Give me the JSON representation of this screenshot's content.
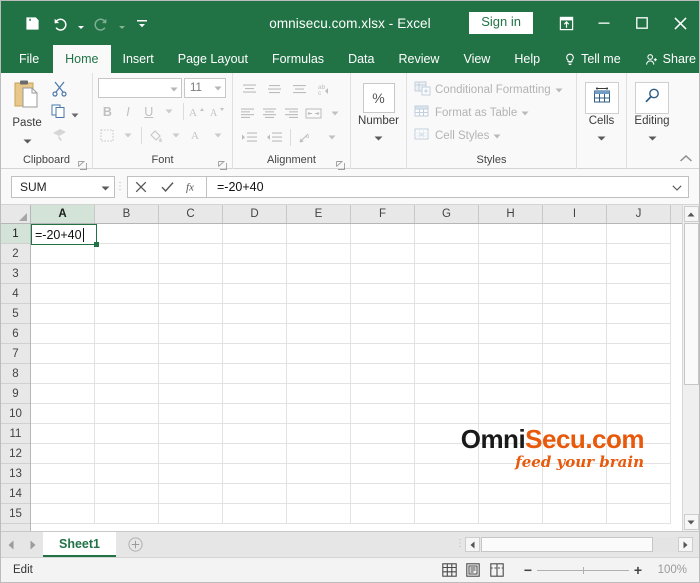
{
  "titlebar": {
    "document_title": "omnisecu.com.xlsx  -  Excel",
    "signin_label": "Sign in",
    "qat": [
      {
        "name": "save-icon",
        "label": "Save"
      },
      {
        "name": "undo-icon",
        "label": "Undo"
      },
      {
        "name": "redo-icon",
        "label": "Redo"
      },
      {
        "name": "customize-qat-icon",
        "label": "Customize Quick Access Toolbar"
      }
    ],
    "window_buttons": [
      {
        "name": "ribbon-display-options-button",
        "label": "Ribbon Display Options"
      },
      {
        "name": "minimize-button",
        "label": "Minimize"
      },
      {
        "name": "maximize-button",
        "label": "Maximize"
      },
      {
        "name": "close-button",
        "label": "Close"
      }
    ],
    "accent_color": "#217346"
  },
  "ribbon_tabs": [
    {
      "label": "File",
      "active": false
    },
    {
      "label": "Home",
      "active": true
    },
    {
      "label": "Insert",
      "active": false
    },
    {
      "label": "Page Layout",
      "active": false
    },
    {
      "label": "Formulas",
      "active": false
    },
    {
      "label": "Data",
      "active": false
    },
    {
      "label": "Review",
      "active": false
    },
    {
      "label": "View",
      "active": false
    },
    {
      "label": "Help",
      "active": false
    },
    {
      "label": "Tell me",
      "active": false
    },
    {
      "label": "Share",
      "active": false
    }
  ],
  "ribbon": {
    "groups": {
      "clipboard": {
        "label": "Clipboard",
        "paste_label": "Paste",
        "items": [
          "cut-icon",
          "copy-icon",
          "format-painter-icon"
        ]
      },
      "font": {
        "label": "Font",
        "font_name_value": "",
        "font_size_value": "11",
        "buttons": [
          "bold-icon",
          "italic-icon",
          "underline-icon",
          "increase-font-size-icon",
          "decrease-font-size-icon",
          "borders-icon",
          "fill-color-icon",
          "font-color-icon"
        ]
      },
      "alignment": {
        "label": "Alignment",
        "buttons": [
          "align-top-icon",
          "align-middle-icon",
          "align-bottom-icon",
          "orientation-icon",
          "align-left-icon",
          "align-center-icon",
          "align-right-icon",
          "wrap-text-icon",
          "decrease-indent-icon",
          "increase-indent-icon",
          "merge-and-center-icon"
        ]
      },
      "number": {
        "label": "Number",
        "button_label": "Number",
        "glyph": "%"
      },
      "styles": {
        "label": "Styles",
        "items": [
          {
            "label": "Conditional Formatting",
            "icon": "conditional-formatting-icon"
          },
          {
            "label": "Format as Table",
            "icon": "format-as-table-icon"
          },
          {
            "label": "Cell Styles",
            "icon": "cell-styles-icon"
          }
        ]
      },
      "cells": {
        "label": "Cells",
        "button_label": "Cells",
        "icon": "cells-icon"
      },
      "editing": {
        "label": "Editing",
        "button_label": "Editing",
        "icon": "editing-magnifier-icon"
      }
    }
  },
  "formula_bar": {
    "name_box_value": "SUM",
    "cancel_label": "Cancel",
    "enter_label": "Enter",
    "fx_label": "Insert Function",
    "formula_value": "=-20+40"
  },
  "grid": {
    "columns": [
      "A",
      "B",
      "C",
      "D",
      "E",
      "F",
      "G",
      "H",
      "I",
      "J"
    ],
    "rows": [
      "1",
      "2",
      "3",
      "4",
      "5",
      "6",
      "7",
      "8",
      "9",
      "10",
      "11",
      "12",
      "13",
      "14",
      "15"
    ],
    "active_cell": "A1",
    "active_cell_value": "=-20+40",
    "selection_color": "#217346"
  },
  "watermark": {
    "text_dark": "Omni",
    "text_accent": "Secu.com",
    "tagline": "feed your brain",
    "dark_color": "#1a1a1a",
    "accent_color": "#e8590c"
  },
  "sheet_tabs": {
    "tabs": [
      {
        "label": "Sheet1",
        "active": true
      }
    ],
    "add_sheet_label": "New sheet",
    "prev_label": "Previous sheet",
    "next_label": "Next sheet"
  },
  "status_bar": {
    "mode": "Edit",
    "views": [
      {
        "name": "normal-view-button",
        "label": "Normal"
      },
      {
        "name": "page-layout-view-button",
        "label": "Page Layout"
      },
      {
        "name": "page-break-preview-button",
        "label": "Page Break Preview"
      }
    ],
    "zoom_out_label": "−",
    "zoom_in_label": "+",
    "zoom_level": "100%"
  }
}
